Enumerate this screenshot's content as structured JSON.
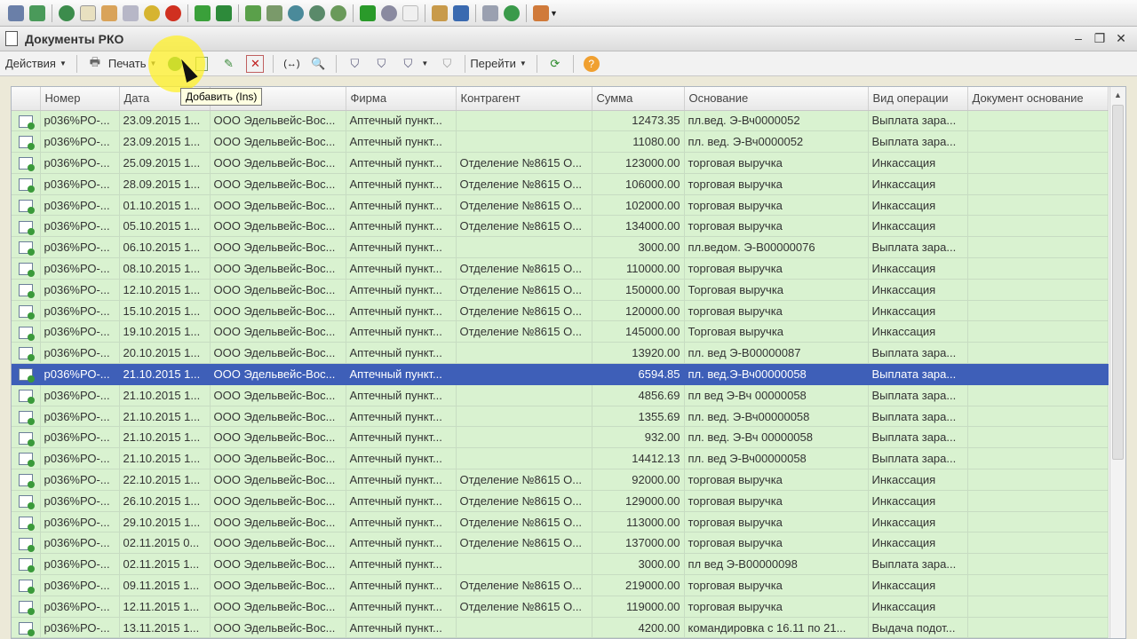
{
  "app_toolbar": {
    "icons": [
      "books-icon",
      "refresh-people-icon",
      "globe-icon",
      "tag-icon",
      "hand-icon",
      "calculator-icon",
      "coins-icon",
      "close-red-icon",
      "arrow-down-green-icon",
      "arrows-green-icon",
      "sheet-green-icon",
      "search-globe-icon",
      "globe2-icon",
      "globe3-icon",
      "globe4-icon",
      "plus-green-icon",
      "disk-icon",
      "doc-icon",
      "arrow-right-icon",
      "box-blue-icon",
      "table-icon",
      "refresh-globe-icon",
      "chart-icon"
    ]
  },
  "window": {
    "title": "Документы РКО",
    "minimize": "–",
    "restore": "❐",
    "close": "✕"
  },
  "form_toolbar": {
    "actions_label": "Действия",
    "print_label": "Печать",
    "goto_label": "Перейти"
  },
  "tooltip": "Добавить (Ins)",
  "table": {
    "columns": [
      "Номер",
      "Дата",
      "",
      "Фирма",
      "Контрагент",
      "Сумма",
      "Основание",
      "Вид операции",
      "Документ основание"
    ],
    "rows": [
      [
        "р036%РО-...",
        "23.09.2015 1...",
        "ООО Эдельвейс-Вос...",
        "Аптечный пункт...",
        "",
        "12473.35",
        "пл.вед. Э-Вч0000052",
        "Выплата зара...",
        ""
      ],
      [
        "р036%РО-...",
        "23.09.2015 1...",
        "ООО Эдельвейс-Вос...",
        "Аптечный пункт...",
        "",
        "11080.00",
        "пл. вед. Э-Вч0000052",
        "Выплата зара...",
        ""
      ],
      [
        "р036%РО-...",
        "25.09.2015 1...",
        "ООО Эдельвейс-Вос...",
        "Аптечный пункт...",
        "Отделение №8615 О...",
        "123000.00",
        "торговая выручка",
        "Инкассация",
        ""
      ],
      [
        "р036%РО-...",
        "28.09.2015 1...",
        "ООО Эдельвейс-Вос...",
        "Аптечный пункт...",
        "Отделение №8615 О...",
        "106000.00",
        "торговая выручка",
        "Инкассация",
        ""
      ],
      [
        "р036%РО-...",
        "01.10.2015 1...",
        "ООО Эдельвейс-Вос...",
        "Аптечный пункт...",
        "Отделение №8615 О...",
        "102000.00",
        "торговая выручка",
        "Инкассация",
        ""
      ],
      [
        "р036%РО-...",
        "05.10.2015 1...",
        "ООО Эдельвейс-Вос...",
        "Аптечный пункт...",
        "Отделение №8615 О...",
        "134000.00",
        "торговая выручка",
        "Инкассация",
        ""
      ],
      [
        "р036%РО-...",
        "06.10.2015 1...",
        "ООО Эдельвейс-Вос...",
        "Аптечный пункт...",
        "",
        "3000.00",
        "пл.ведом. Э-В00000076",
        "Выплата зара...",
        ""
      ],
      [
        "р036%РО-...",
        "08.10.2015 1...",
        "ООО Эдельвейс-Вос...",
        "Аптечный пункт...",
        "Отделение №8615 О...",
        "110000.00",
        "торговая выручка",
        "Инкассация",
        ""
      ],
      [
        "р036%РО-...",
        "12.10.2015 1...",
        "ООО Эдельвейс-Вос...",
        "Аптечный пункт...",
        "Отделение №8615 О...",
        "150000.00",
        "Торговая выручка",
        "Инкассация",
        ""
      ],
      [
        "р036%РО-...",
        "15.10.2015 1...",
        "ООО Эдельвейс-Вос...",
        "Аптечный пункт...",
        "Отделение №8615 О...",
        "120000.00",
        "торговая выручка",
        "Инкассация",
        ""
      ],
      [
        "р036%РО-...",
        "19.10.2015 1...",
        "ООО Эдельвейс-Вос...",
        "Аптечный пункт...",
        "Отделение №8615 О...",
        "145000.00",
        "Торговая выручка",
        "Инкассация",
        ""
      ],
      [
        "р036%РО-...",
        "20.10.2015 1...",
        "ООО Эдельвейс-Вос...",
        "Аптечный пункт...",
        "",
        "13920.00",
        "пл. вед Э-В00000087",
        "Выплата зара...",
        ""
      ],
      [
        "р036%РО-...",
        "21.10.2015 1...",
        "ООО Эдельвейс-Вос...",
        "Аптечный пункт...",
        "",
        "6594.85",
        "пл. вед.Э-Вч00000058",
        "Выплата зара...",
        ""
      ],
      [
        "р036%РО-...",
        "21.10.2015 1...",
        "ООО Эдельвейс-Вос...",
        "Аптечный пункт...",
        "",
        "4856.69",
        "пл вед Э-Вч 00000058",
        "Выплата зара...",
        ""
      ],
      [
        "р036%РО-...",
        "21.10.2015 1...",
        "ООО Эдельвейс-Вос...",
        "Аптечный пункт...",
        "",
        "1355.69",
        "пл. вед. Э-Вч00000058",
        "Выплата зара...",
        ""
      ],
      [
        "р036%РО-...",
        "21.10.2015 1...",
        "ООО Эдельвейс-Вос...",
        "Аптечный пункт...",
        "",
        "932.00",
        "пл. вед. Э-Вч 00000058",
        "Выплата зара...",
        ""
      ],
      [
        "р036%РО-...",
        "21.10.2015 1...",
        "ООО Эдельвейс-Вос...",
        "Аптечный пункт...",
        "",
        "14412.13",
        "пл. вед Э-Вч00000058",
        "Выплата зара...",
        ""
      ],
      [
        "р036%РО-...",
        "22.10.2015 1...",
        "ООО Эдельвейс-Вос...",
        "Аптечный пункт...",
        "Отделение №8615 О...",
        "92000.00",
        "торговая выручка",
        "Инкассация",
        ""
      ],
      [
        "р036%РО-...",
        "26.10.2015 1...",
        "ООО Эдельвейс-Вос...",
        "Аптечный пункт...",
        "Отделение №8615 О...",
        "129000.00",
        "торговая выручка",
        "Инкассация",
        ""
      ],
      [
        "р036%РО-...",
        "29.10.2015 1...",
        "ООО Эдельвейс-Вос...",
        "Аптечный пункт...",
        "Отделение №8615 О...",
        "113000.00",
        "торговая выручка",
        "Инкассация",
        ""
      ],
      [
        "р036%РО-...",
        "02.11.2015 0...",
        "ООО Эдельвейс-Вос...",
        "Аптечный пункт...",
        "Отделение №8615 О...",
        "137000.00",
        "торговая выручка",
        "Инкассация",
        ""
      ],
      [
        "р036%РО-...",
        "02.11.2015 1...",
        "ООО Эдельвейс-Вос...",
        "Аптечный пункт...",
        "",
        "3000.00",
        "пл вед Э-В00000098",
        "Выплата зара...",
        ""
      ],
      [
        "р036%РО-...",
        "09.11.2015 1...",
        "ООО Эдельвейс-Вос...",
        "Аптечный пункт...",
        "Отделение №8615 О...",
        "219000.00",
        "торговая выручка",
        "Инкассация",
        ""
      ],
      [
        "р036%РО-...",
        "12.11.2015 1...",
        "ООО Эдельвейс-Вос...",
        "Аптечный пункт...",
        "Отделение №8615 О...",
        "119000.00",
        "торговая выручка",
        "Инкассация",
        ""
      ],
      [
        "р036%РО-...",
        "13.11.2015 1...",
        "ООО Эдельвейс-Вос...",
        "Аптечный пункт...",
        "",
        "4200.00",
        "командировка с 16.11 по 21...",
        "Выдача подот...",
        ""
      ]
    ],
    "selected_row": 12
  },
  "colors": {
    "row_bg": "#d9f2d0",
    "selected_bg": "#3e5fb8",
    "highlight": "#fff028"
  }
}
